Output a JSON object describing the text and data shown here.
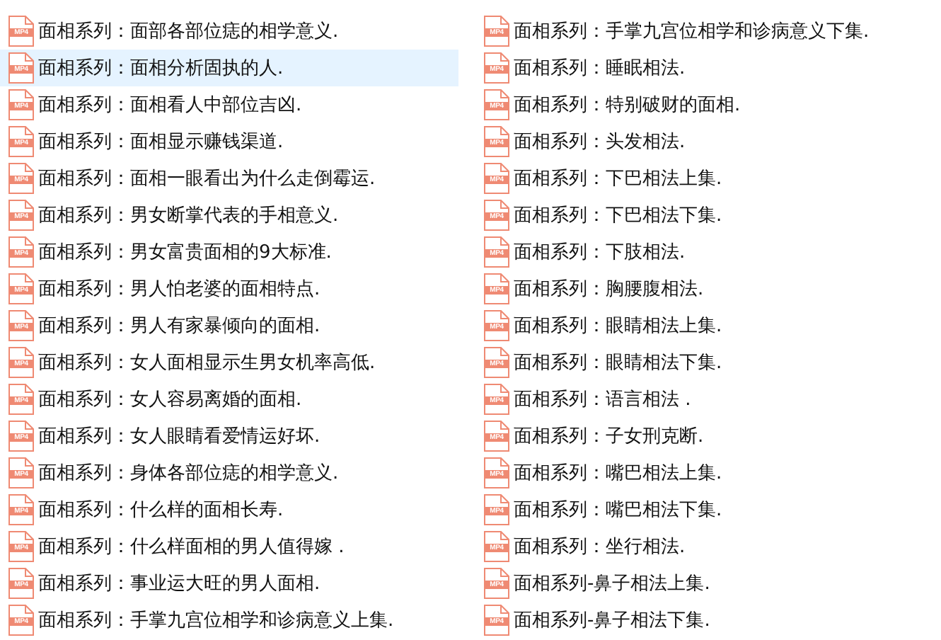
{
  "files": [
    {
      "name": "面相系列：面部各部位痣的相学意义.",
      "badge": "MP4",
      "selected": false
    },
    {
      "name": "面相系列：面相分析固执的人.",
      "badge": "MP4",
      "selected": true
    },
    {
      "name": "面相系列：面相看人中部位吉凶.",
      "badge": "MP4",
      "selected": false
    },
    {
      "name": "面相系列：面相显示赚钱渠道.",
      "badge": "MP4",
      "selected": false
    },
    {
      "name": "面相系列：面相一眼看出为什么走倒霉运.",
      "badge": "MP4",
      "selected": false
    },
    {
      "name": "面相系列：男女断掌代表的手相意义.",
      "badge": "MP4",
      "selected": false
    },
    {
      "name": "面相系列：男女富贵面相的9大标准.",
      "badge": "MP4",
      "selected": false
    },
    {
      "name": "面相系列：男人怕老婆的面相特点.",
      "badge": "MP4",
      "selected": false
    },
    {
      "name": "面相系列：男人有家暴倾向的面相.",
      "badge": "MP4",
      "selected": false
    },
    {
      "name": "面相系列：女人面相显示生男女机率高低.",
      "badge": "MP4",
      "selected": false
    },
    {
      "name": "面相系列：女人容易离婚的面相.",
      "badge": "MP4",
      "selected": false
    },
    {
      "name": "面相系列：女人眼睛看爱情运好坏.",
      "badge": "MP4",
      "selected": false
    },
    {
      "name": "面相系列：身体各部位痣的相学意义.",
      "badge": "MP4",
      "selected": false
    },
    {
      "name": "面相系列：什么样的面相长寿.",
      "badge": "MP4",
      "selected": false
    },
    {
      "name": "面相系列：什么样面相的男人值得嫁 .",
      "badge": "MP4",
      "selected": false
    },
    {
      "name": "面相系列：事业运大旺的男人面相.",
      "badge": "MP4",
      "selected": false
    },
    {
      "name": "面相系列：手掌九宫位相学和诊病意义上集.",
      "badge": "MP4",
      "selected": false
    },
    {
      "name": "面相系列：手掌九宫位相学和诊病意义下集.",
      "badge": "MP4",
      "selected": false
    },
    {
      "name": "面相系列：睡眠相法.",
      "badge": "MP4",
      "selected": false
    },
    {
      "name": "面相系列：特别破财的面相.",
      "badge": "MP4",
      "selected": false
    },
    {
      "name": "面相系列：头发相法.",
      "badge": "MP4",
      "selected": false
    },
    {
      "name": "面相系列：下巴相法上集.",
      "badge": "MP4",
      "selected": false
    },
    {
      "name": "面相系列：下巴相法下集.",
      "badge": "MP4",
      "selected": false
    },
    {
      "name": "面相系列：下肢相法.",
      "badge": "MP4",
      "selected": false
    },
    {
      "name": "面相系列：胸腰腹相法.",
      "badge": "MP4",
      "selected": false
    },
    {
      "name": "面相系列：眼睛相法上集.",
      "badge": "MP4",
      "selected": false
    },
    {
      "name": "面相系列：眼睛相法下集.",
      "badge": "MP4",
      "selected": false
    },
    {
      "name": "面相系列：语言相法 .",
      "badge": "MP4",
      "selected": false
    },
    {
      "name": "面相系列：子女刑克断.",
      "badge": "MP4",
      "selected": false
    },
    {
      "name": "面相系列：嘴巴相法上集.",
      "badge": "MP4",
      "selected": false
    },
    {
      "name": "面相系列：嘴巴相法下集.",
      "badge": "MP4",
      "selected": false
    },
    {
      "name": "面相系列：坐行相法.",
      "badge": "MP4",
      "selected": false
    },
    {
      "name": "面相系列-鼻子相法上集.",
      "badge": "MP4",
      "selected": false
    },
    {
      "name": "面相系列-鼻子相法下集.",
      "badge": "MP4",
      "selected": false
    }
  ]
}
